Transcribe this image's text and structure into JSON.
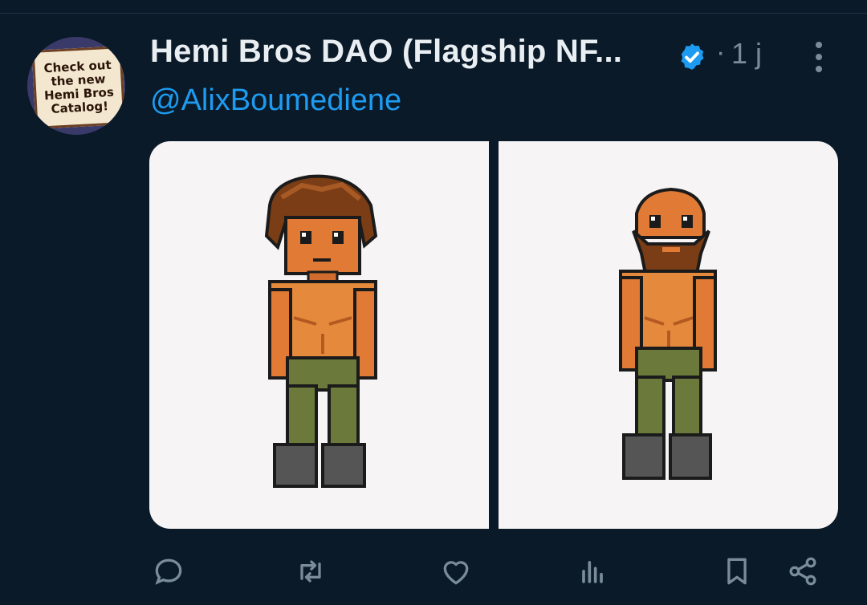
{
  "tweet": {
    "author_name": "Hemi Bros DAO (Flagship NF...",
    "separator": "·",
    "time": "1 j",
    "handle": "@AlixBoumediene",
    "avatar_sign_lines": [
      "Check out",
      "the new",
      "Hemi Bros",
      "Catalog!"
    ]
  },
  "colors": {
    "background": "#0a1a28",
    "name": "#e9eef2",
    "handle": "#1d9bf0",
    "muted": "#7a8b99",
    "verified": "#1d9bf0"
  },
  "media": [
    {
      "name": "character-long-hair"
    },
    {
      "name": "character-bald-bearded"
    }
  ],
  "actions": [
    {
      "name": "reply-icon"
    },
    {
      "name": "retweet-icon"
    },
    {
      "name": "like-icon"
    },
    {
      "name": "views-icon"
    },
    {
      "name": "bookmark-icon"
    },
    {
      "name": "share-icon"
    }
  ]
}
